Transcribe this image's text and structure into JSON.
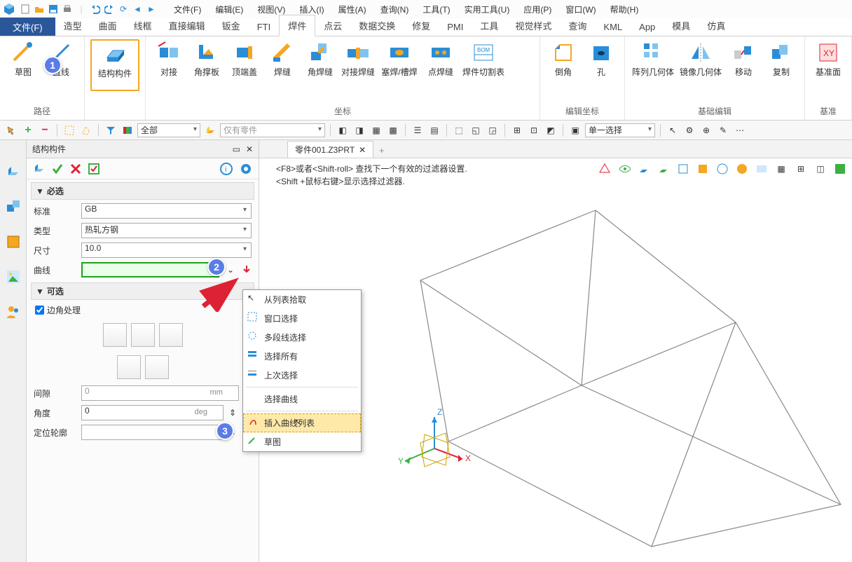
{
  "menus": [
    "文件(F)",
    "编辑(E)",
    "视图(V)",
    "插入(I)",
    "属性(A)",
    "查询(N)",
    "工具(T)",
    "实用工具(U)",
    "应用(P)",
    "窗口(W)",
    "帮助(H)"
  ],
  "tabs": {
    "file": "文件(F)",
    "items": [
      "造型",
      "曲面",
      "线框",
      "直接编辑",
      "钣金",
      "FTI",
      "焊件",
      "点云",
      "数据交换",
      "修复",
      "PMI",
      "工具",
      "视觉样式",
      "查询",
      "KML",
      "App",
      "模具",
      "仿真"
    ],
    "active_index": 6
  },
  "ribbon": {
    "groups": [
      {
        "name": "路径",
        "items": [
          "草图",
          "直线"
        ]
      },
      {
        "name": "",
        "items": [
          "结构构件"
        ]
      },
      {
        "name": "坐标",
        "items": [
          "对接",
          "角撑板",
          "顶端盖",
          "焊缝",
          "角焊缝",
          "对接焊缝",
          "塞焊/槽焊",
          "点焊缝",
          "焊件切割表"
        ]
      },
      {
        "name": "编辑坐标",
        "items": [
          "倒角",
          "孔"
        ]
      },
      {
        "name": "基础编辑",
        "items": [
          "阵列几何体",
          "镜像几何体",
          "移动",
          "复制"
        ]
      },
      {
        "name": "基准",
        "items": [
          "基准面"
        ]
      }
    ]
  },
  "toolbar2": {
    "combo1": "全部",
    "combo2": "仅有零件",
    "combo3": "单一选择"
  },
  "panel": {
    "title": "结构构件",
    "section_required": "必选",
    "section_optional": "可选",
    "label_std": "标准",
    "value_std": "GB",
    "label_type": "类型",
    "value_type": "热轧方钢",
    "label_size": "尺寸",
    "value_size": "10.0",
    "label_curve": "曲线",
    "value_curve": "",
    "label_corner": "边角处理",
    "label_gap": "间隙",
    "value_gap": "0",
    "unit_gap": "mm",
    "label_angle": "角度",
    "value_angle": "0",
    "unit_angle": "deg",
    "label_profile": "定位轮廓",
    "value_profile": ""
  },
  "doc": {
    "tab": "零件001.Z3PRT"
  },
  "hint": {
    "l1": "<F8>或者<Shift-roll> 查找下一个有效的过滤器设置.",
    "l2": "<Shift +鼠标右键>显示选择过滤器."
  },
  "ctx": {
    "items": [
      "从列表拾取",
      "窗口选择",
      "多段线选择",
      "选择所有",
      "上次选择",
      "选择曲线",
      "插入曲线列表",
      "草图"
    ],
    "separators_after": [
      4,
      5
    ],
    "selected_index": 6
  },
  "badges": {
    "b1": "1",
    "b2": "2",
    "b3": "3"
  }
}
